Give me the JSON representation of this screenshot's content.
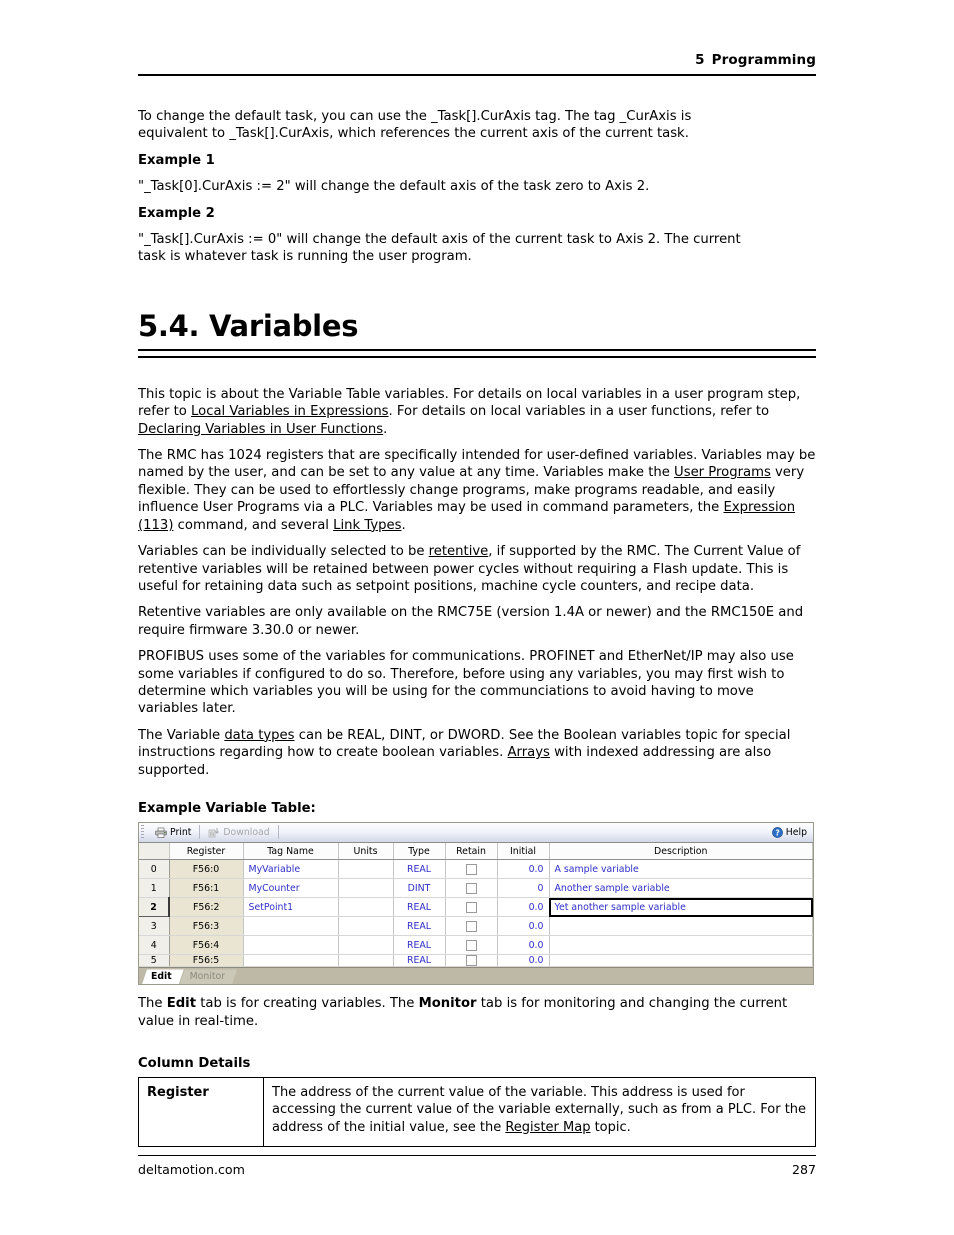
{
  "header": {
    "chapter_number": "5",
    "chapter_title": "Programming"
  },
  "intro": {
    "paragraph": "To change the default task, you can use the _Task[].CurAxis tag.  The tag _CurAxis is equivalent to _Task[].CurAxis, which references the current axis of the current task.",
    "example1_label": "Example 1",
    "example1_text": "\"_Task[0].CurAxis := 2\" will change the default axis of the task zero to Axis 2.",
    "example2_label": "Example 2",
    "example2_text": "\"_Task[].CurAxis := 0\" will change the default axis of the current task to Axis 2. The current task is whatever task is running the user program."
  },
  "section": {
    "heading": "5.4. Variables"
  },
  "paragraphs": {
    "p1_a": "This topic is about the Variable Table variables. For details on local variables in a user program step, refer to ",
    "p1_link1": "Local Variables in Expressions",
    "p1_b": ". For details on local variables in a user functions, refer to ",
    "p1_link2": "Declaring Variables in User Functions",
    "p1_c": ".",
    "p2_a": "The RMC has 1024 registers that are specifically intended for user-defined variables. Variables may be named by the user, and can be set to any value at any time. Variables make the ",
    "p2_link1": "User Programs",
    "p2_b": " very flexible. They can be used to effortlessly change programs, make programs readable, and easily influence User Programs via a PLC. Variables may be used in command parameters, the ",
    "p2_link2": "Expression (113)",
    "p2_c": " command, and several ",
    "p2_link3": "Link Types",
    "p2_d": ".",
    "p3_a": "Variables can be individually selected to be ",
    "p3_link1": "retentive",
    "p3_b": ", if supported by the RMC. The Current Value of retentive variables will be retained between power cycles without requiring a Flash update. This is useful for retaining data such as setpoint positions, machine cycle counters, and recipe data.",
    "p4": "Retentive variables are only available on the RMC75E (version 1.4A or newer) and the RMC150E and require firmware 3.30.0 or newer.",
    "p5": "PROFIBUS uses some of the variables for communications. PROFINET and EtherNet/IP may also use some variables if configured to do so. Therefore, before using any variables, you may first wish to determine which variables you will be using for the communciations to avoid having to move variables later.",
    "p6_a": "The Variable ",
    "p6_link1": "data types",
    "p6_b": " can be REAL, DINT, or DWORD. See the Boolean variables topic for special instructions regarding how to create boolean variables. ",
    "p6_link2": "Arrays",
    "p6_c": " with indexed addressing are also supported."
  },
  "example_table": {
    "caption": "Example Variable Table:",
    "toolbar": {
      "print_label": "Print",
      "download_label": "Download",
      "help_label": "Help"
    },
    "columns": [
      "Register",
      "Tag Name",
      "Units",
      "Type",
      "Retain",
      "Initial",
      "Description"
    ],
    "rows": [
      {
        "index": "0",
        "register": "F56:0",
        "tag": "MyVariable",
        "units": "",
        "type": "REAL",
        "retain": false,
        "initial": "0.0",
        "description": "A sample variable"
      },
      {
        "index": "1",
        "register": "F56:1",
        "tag": "MyCounter",
        "units": "",
        "type": "DINT",
        "retain": false,
        "initial": "0",
        "description": "Another sample variable"
      },
      {
        "index": "2",
        "register": "F56:2",
        "tag": "SetPoint1",
        "units": "",
        "type": "REAL",
        "retain": false,
        "initial": "0.0",
        "description": "Yet another sample variable"
      },
      {
        "index": "3",
        "register": "F56:3",
        "tag": "",
        "units": "",
        "type": "REAL",
        "retain": false,
        "initial": "0.0",
        "description": ""
      },
      {
        "index": "4",
        "register": "F56:4",
        "tag": "",
        "units": "",
        "type": "REAL",
        "retain": false,
        "initial": "0.0",
        "description": ""
      },
      {
        "index": "5",
        "register": "F56:5",
        "tag": "",
        "units": "",
        "type": "REAL",
        "retain": false,
        "initial": "0.0",
        "description": ""
      }
    ],
    "tabs": [
      {
        "label": "Edit",
        "active": true
      },
      {
        "label": "Monitor",
        "active": false
      }
    ],
    "colors": {
      "link_text": "#2f2fc9",
      "register_cell_bg": "#e9e5d2",
      "tabstrip_bg": "#bdb9a6",
      "help_icon": "#2d6fc4"
    }
  },
  "after_table": {
    "a": "The ",
    "edit_bold": "Edit",
    "b": " tab is for creating variables. The ",
    "monitor_bold": "Monitor",
    "c": " tab is for monitoring and changing the current value in real-time."
  },
  "column_details": {
    "heading": "Column Details",
    "rows": [
      {
        "key": "Register",
        "text_a": "The address of the current value of the variable. This address is used for accessing the current value of the variable externally, such as from a PLC. For the address of the initial value, see the ",
        "link": "Register Map",
        "text_b": " topic."
      }
    ]
  },
  "footer": {
    "site": "deltamotion.com",
    "page_number": "287"
  }
}
